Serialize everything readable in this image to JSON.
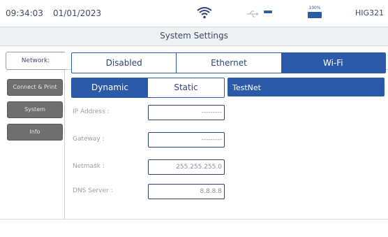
{
  "status": {
    "time": "09:34:03",
    "date": "01/01/2023",
    "battery_label": "100%",
    "model": "HIG321",
    "icons": [
      "wifi-icon",
      "usb-icon",
      "battery-icon"
    ],
    "accent_color": "#2a5aa8"
  },
  "title": "System Settings",
  "nav": {
    "network_label": "Network:",
    "items": [
      {
        "label": "Connect & Print"
      },
      {
        "label": "System"
      },
      {
        "label": "Info"
      }
    ]
  },
  "network_mode": {
    "options": [
      "Disabled",
      "Ethernet",
      "Wi-Fi"
    ],
    "selected": "Wi-Fi"
  },
  "ip_mode": {
    "options": [
      "Dynamic",
      "Static"
    ],
    "selected": "Dynamic"
  },
  "ssid": "TestNet",
  "fields": [
    {
      "label": "IP Address :",
      "value": "---------"
    },
    {
      "label": "Gateway :",
      "value": "---------"
    },
    {
      "label": "Netmask :",
      "value": "255.255.255.0"
    },
    {
      "label": "DNS Server :",
      "value": "8.8.8.8"
    }
  ]
}
